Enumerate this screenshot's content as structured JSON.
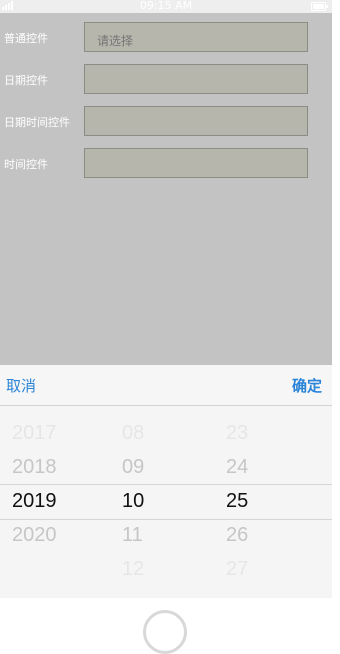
{
  "status_bar": {
    "time": "09:15 AM"
  },
  "form": {
    "rows": [
      {
        "label": "普通控件",
        "value": "",
        "placeholder": "请选择"
      },
      {
        "label": "日期控件",
        "value": "",
        "placeholder": ""
      },
      {
        "label": "日期时间控件",
        "value": "",
        "placeholder": ""
      },
      {
        "label": "时间控件",
        "value": "",
        "placeholder": ""
      }
    ]
  },
  "picker": {
    "cancel_label": "取消",
    "confirm_label": "确定",
    "columns": [
      {
        "name": "year",
        "options": [
          "2017",
          "2018",
          "2019",
          "2020"
        ],
        "selected": "2019"
      },
      {
        "name": "month",
        "options": [
          "08",
          "09",
          "10",
          "11",
          "12"
        ],
        "selected": "10"
      },
      {
        "name": "day",
        "options": [
          "23",
          "24",
          "25",
          "26",
          "27"
        ],
        "selected": "25"
      }
    ]
  },
  "colors": {
    "accent": "#2a84d8",
    "overlay": "#c3c3c3"
  }
}
